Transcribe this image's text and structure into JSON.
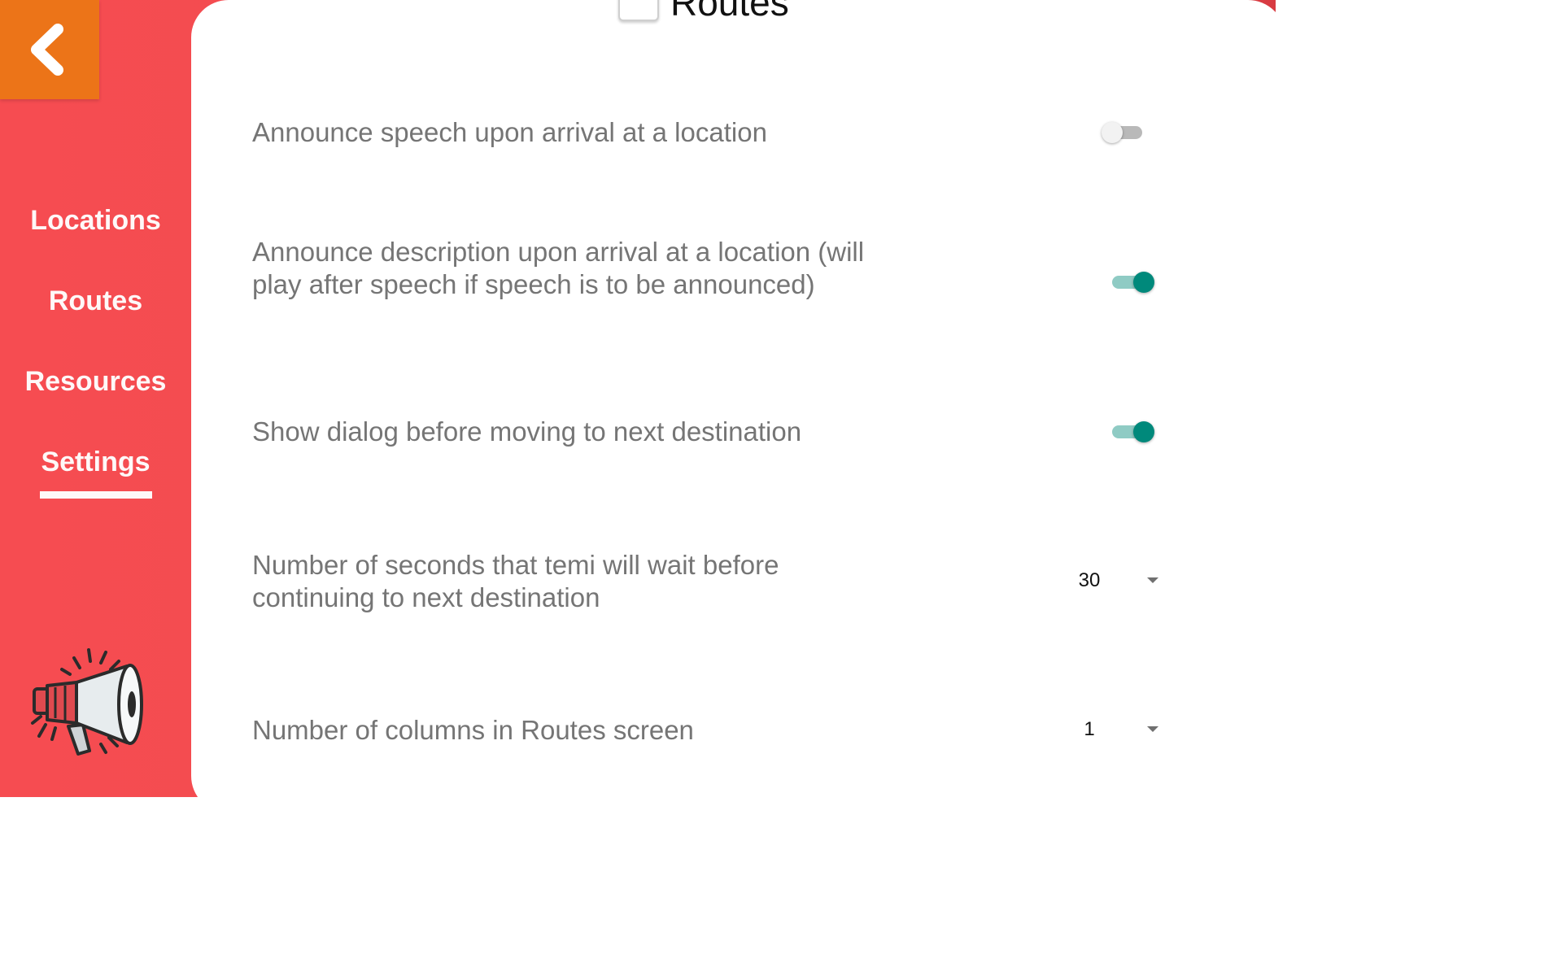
{
  "header": {
    "title": "Routes"
  },
  "sidebar": {
    "items": [
      {
        "label": "Locations"
      },
      {
        "label": "Routes"
      },
      {
        "label": "Resources"
      },
      {
        "label": "Settings",
        "active": true
      }
    ],
    "back_icon": "chevron-left-icon",
    "mascot_icon": "megaphone-icon"
  },
  "settings": [
    {
      "label": "Announce speech upon arrival at a location",
      "control": "toggle",
      "on": false
    },
    {
      "label": "Announce description upon arrival at a location (will play after speech if speech is to be announced)",
      "control": "toggle",
      "on": true
    },
    {
      "label": "Show dialog before moving to next destination",
      "control": "toggle",
      "on": true
    },
    {
      "label": "Number of seconds that temi will wait before continuing to next destination",
      "control": "dropdown",
      "value": "30"
    },
    {
      "label": "Number of columns in Routes screen",
      "control": "dropdown",
      "value": "1"
    }
  ],
  "colors": {
    "sidebar_red": "#f64c51",
    "back_orange": "#ec7418",
    "toggle_on": "#00897b",
    "label_gray": "#757575"
  }
}
